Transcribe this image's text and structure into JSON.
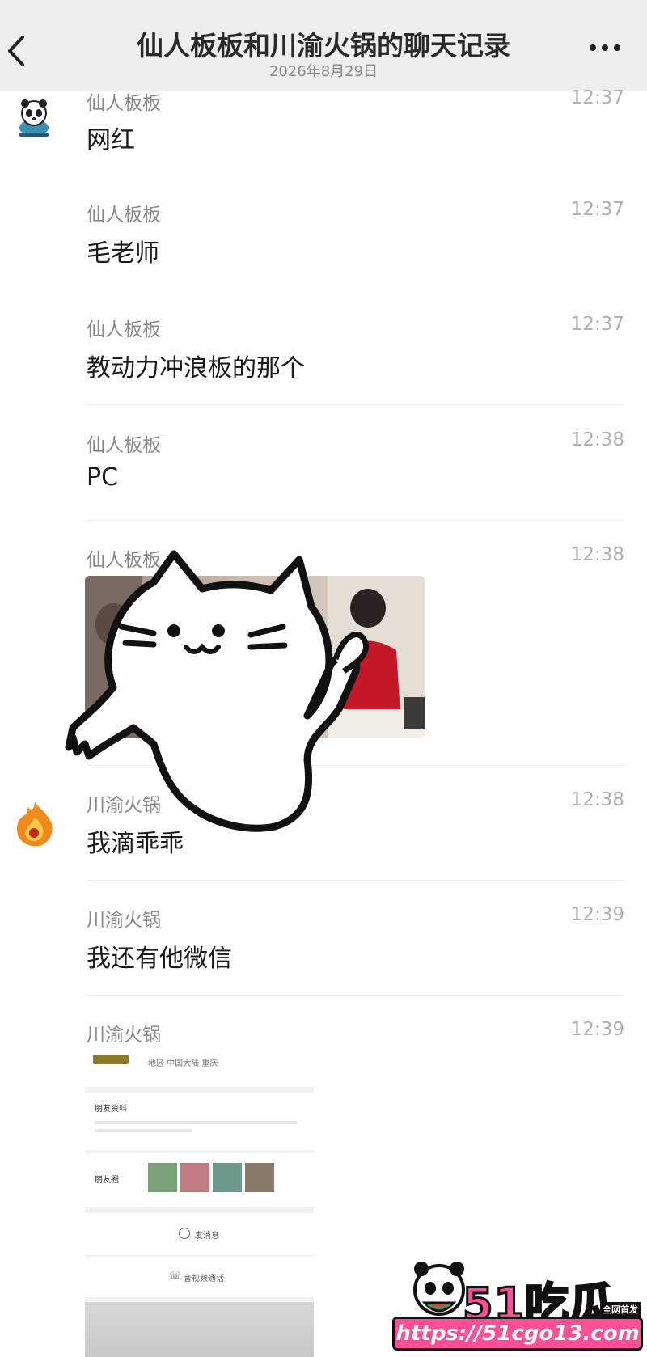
{
  "header": {
    "title": "仙人板板和川渝火锅的聊天记录",
    "date": "2026年8月29日"
  },
  "icons": {
    "back": "chevron-left-icon",
    "more": "more-dots-icon"
  },
  "messages": [
    {
      "sender": "仙人板板",
      "time": "12:37",
      "text": "网红"
    },
    {
      "sender": "仙人板板",
      "time": "12:37",
      "text": "毛老师"
    },
    {
      "sender": "仙人板板",
      "time": "12:37",
      "text": "教动力冲浪板的那个"
    },
    {
      "sender": "仙人板板",
      "time": "12:38",
      "text": "PC"
    },
    {
      "sender": "仙人板板",
      "time": "12:38",
      "text": ""
    },
    {
      "sender": "川渝火锅",
      "time": "12:38",
      "text": "我滴乖乖"
    },
    {
      "sender": "川渝火锅",
      "time": "12:39",
      "text": "我还有他微信"
    },
    {
      "sender": "川渝火锅",
      "time": "12:39",
      "text": ""
    }
  ],
  "screenshot_card": {
    "top_meta": "地区  中国大陆  重庆",
    "profile_label": "朋友资料",
    "moments_label": "朋友圈",
    "send_message": "发消息",
    "video_call": "音视频通话"
  },
  "watermark": {
    "logo": "51吃瓜",
    "badge": "全网首发",
    "url": "https://51cgo13.com"
  },
  "colors": {
    "header_bg": "#ededed",
    "sender": "#8a8a8a",
    "time": "#b0b0b0",
    "watermark_pink": "#ff4f96"
  }
}
